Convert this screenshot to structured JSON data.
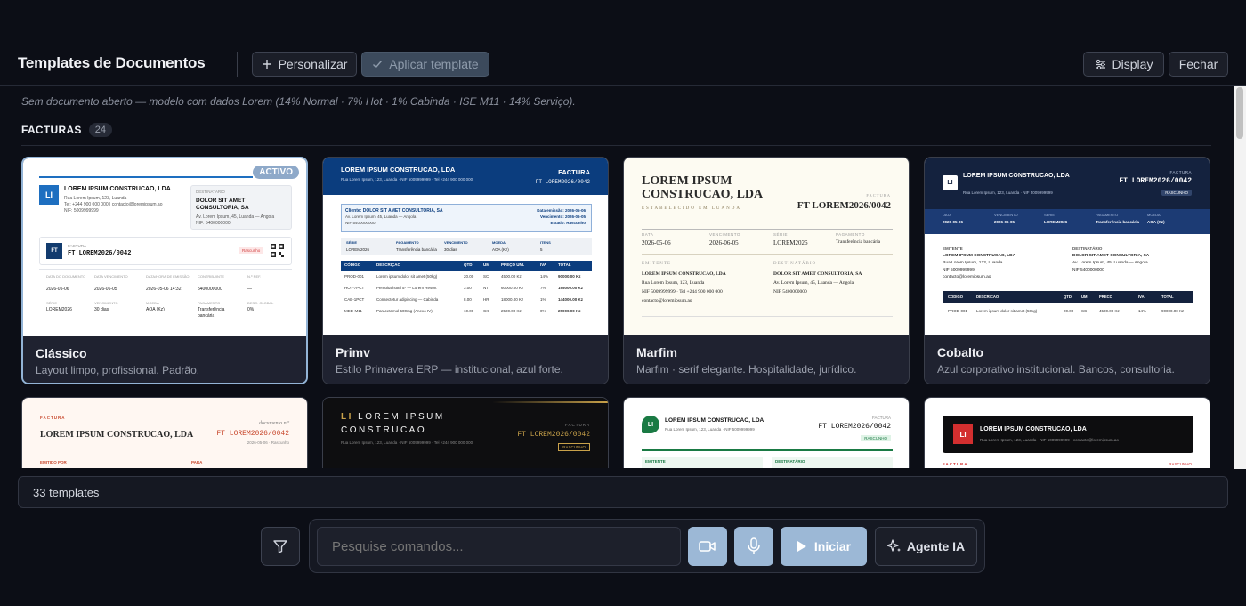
{
  "header": {
    "title": "Templates de Documentos",
    "customize_label": "Personalizar",
    "apply_label": "Aplicar template",
    "display_label": "Display",
    "close_label": "Fechar"
  },
  "subtitle": "Sem documento aberto — modelo com dados Lorem (14% Normal · 7% Hot · 1% Cabinda · ISE M11 · 14% Serviço).",
  "section": {
    "label": "FACTURAS",
    "count": "24"
  },
  "active_badge": "ACTIVO",
  "colors": {
    "accent": "#9cb8d6",
    "background": "#0c0e16",
    "card": "#1f2230",
    "active_border": "#93b4d6"
  },
  "cards": [
    {
      "name": "Clássico",
      "desc": "Layout limpo, profissional. Padrão.",
      "active": true
    },
    {
      "name": "Primv",
      "desc": "Estilo Primavera ERP — institucional, azul forte."
    },
    {
      "name": "Marfim",
      "desc": "Marfim · serif elegante. Hospitalidade, jurídico."
    },
    {
      "name": "Cobalto",
      "desc": "Azul corporativo institucional. Bancos, consultoria."
    }
  ],
  "previews": {
    "classico": {
      "company": "LOREM IPSUM CONSTRUCAO, LDA",
      "address": "Rua Lorem Ipsum, 123, Luanda",
      "contact": "Tel: +244 900 000 000 | contacto@loremipsum.ao",
      "nif": "NIF: 5009999999",
      "logo": "LI",
      "dest_label": "DESTINATÁRIO",
      "dest_name": "DOLOR SIT AMET CONSULTORIA, SA",
      "dest_addr": "Av. Lorem Ipsum, 45, Luanda — Angola",
      "dest_nif": "NIF: 5400000000",
      "ft_logo": "FT",
      "doc_type": "FACTURA",
      "doc_num": "FT LOREM2026/0042",
      "status": "Rascunho",
      "row1_labels": [
        "DATA DO DOCUMENTO",
        "DATA VENCIMENTO",
        "DATA/HORA DE EMISSÃO",
        "CONTRIBUINTE",
        "N.º REF."
      ],
      "row1_values": [
        "2026-05-06",
        "2026-06-05",
        "2026-05-06 14:32",
        "5400000000",
        "—"
      ],
      "row2_labels": [
        "SÉRIE",
        "VENCIMENTO",
        "MOEDA",
        "PAGAMENTO",
        "DESC. GLOBAL"
      ],
      "row2_values": [
        "LOREM2026",
        "30 dias",
        "AOA (Kz)",
        "Transferência bancária",
        "0%"
      ]
    },
    "primv": {
      "company": "LOREM IPSUM CONSTRUCAO, LDA",
      "address": "Rua Lorem Ipsum, 123, Luanda · NIF 5009999999 · Tel +244 900 000 000",
      "doc_type": "FACTURA",
      "doc_num": "FT LOREM2026/0042",
      "client": "Cliente: DOLOR SIT AMET CONSULTORIA, SA",
      "client_addr": "Av. Lorem Ipsum, 45, Luanda — Angola",
      "client_nif": "NIF 5400000000",
      "dates": [
        "Data emissão: 2026-05-06",
        "Vencimento: 2026-06-05",
        "Estado: Rascunho"
      ],
      "meta_labels": [
        "SÉRIE",
        "PAGAMENTO",
        "VENCIMENTO",
        "MOEDA",
        "ITENS"
      ],
      "meta_values": [
        "LOREM2026",
        "Transferência bancária",
        "30 dias",
        "AOA (Kz)",
        "5"
      ],
      "table_head": [
        "CÓDIGO",
        "DESCRIÇÃO",
        "QTD",
        "UM",
        "PREÇO UNI.",
        "IVA",
        "TOTAL"
      ],
      "rows": [
        [
          "PROD-001",
          "Lorem ipsum dolor sit amet (50kg)",
          "20.00",
          "SC",
          "4500.00 Kz",
          "14%",
          "90000.00 Kz"
        ],
        [
          "HOT-7PCT",
          "Pernoita hotel 5* — Lorem Resort",
          "3.00",
          "NT",
          "60000.00 Kz",
          "7%",
          "195000.00 Kz"
        ],
        [
          "CAB-1PCT",
          "Consectetur adipiscing — Cabinda",
          "8.00",
          "HR",
          "18000.00 Kz",
          "1%",
          "144000.00 Kz"
        ],
        [
          "MED-M11",
          "Paracetamol 500mg (Anexo IV)",
          "10.00",
          "CX",
          "2500.00 Kz",
          "0%",
          "25000.00 Kz"
        ]
      ]
    },
    "marfim": {
      "company": "LOREM IPSUM CONSTRUCAO, LDA",
      "tagline": "ESTABELECIDO EM LUANDA",
      "doc_type": "FACTURA",
      "doc_num": "FT LOREM2026/0042",
      "meta_labels": [
        "DATA",
        "VENCIMENTO",
        "SÉRIE",
        "PAGAMENTO"
      ],
      "meta_values": [
        "2026-05-06",
        "2026-06-05",
        "LOREM2026",
        "Transferência bancária"
      ],
      "emit_label": "EMITENTE",
      "emit": [
        "LOREM IPSUM CONSTRUCAO, LDA",
        "Rua Lorem Ipsum, 123, Luanda",
        "NIF 5009999999 · Tel +244 900 000 000",
        "contacto@loremipsum.ao"
      ],
      "dest_label": "DESTINATÁRIO",
      "dest": [
        "DOLOR SIT AMET CONSULTORIA, SA",
        "Av. Lorem Ipsum, 45, Luanda — Angola",
        "NIF 5400000000"
      ]
    },
    "cobalto": {
      "logo": "LI",
      "company": "LOREM IPSUM CONSTRUCAO, LDA",
      "address": "Rua Lorem Ipsum, 123, Luanda · NIF 5009999999",
      "doc_type": "FACTURA",
      "doc_num": "FT LOREM2026/0042",
      "status": "RASCUNHO",
      "meta_labels": [
        "DATA",
        "VENCIMENTO",
        "SÉRIE",
        "PAGAMENTO",
        "MOEDA"
      ],
      "meta_values": [
        "2026-05-06",
        "2026-06-05",
        "LOREM2026",
        "Transferência bancária",
        "AOA (Kz)"
      ],
      "emit_label": "EMITENTE",
      "emit": [
        "LOREM IPSUM CONSTRUCAO, LDA",
        "Rua Lorem Ipsum, 123, Luanda",
        "NIF 5009999999",
        "contacto@loremipsum.ao"
      ],
      "dest_label": "DESTINATÁRIO",
      "dest": [
        "DOLOR SIT AMET CONSULTORIA, SA",
        "Av. Lorem Ipsum, 45, Luanda — Angola",
        "NIF 5400000000"
      ],
      "table_head": [
        "CODIGO",
        "DESCRICAO",
        "QTD",
        "UM",
        "PRECO",
        "IVA",
        "TOTAL"
      ],
      "row": [
        "PROD-001",
        "Lorem ipsum dolor sit amet (50kg)",
        "20.00",
        "SC",
        "4500.00 Kz",
        "14%",
        "90000.00 Kz"
      ]
    },
    "row2": [
      {
        "doc_type": "FACTURA",
        "company": "LOREM IPSUM CONSTRUCAO, LDA",
        "script": "documento n.º",
        "doc_num": "FT LOREM2026/0042",
        "sub": "2026-05-06 · Rascunho",
        "labels": [
          "EMITIDO POR",
          "PARA"
        ]
      },
      {
        "logo": "LI",
        "company_l1": "LOREM IPSUM",
        "company_l2": "CONSTRUCAO",
        "address": "Rua Lorem Ipsum, 123, Luanda · NIF 5009999999 · Tel +244 900 000 000",
        "doc_type": "FACTURA",
        "doc_num": "FT LOREM2026/0042",
        "status": "RASCUNHO"
      },
      {
        "logo": "LI",
        "company": "LOREM IPSUM CONSTRUCAO, LDA",
        "address": "Rua Lorem Ipsum, 123, Luanda · NIF 5009999999",
        "doc_type": "FACTURA",
        "doc_num": "FT LOREM2026/0042",
        "status": "RASCUNHO",
        "labels": [
          "EMITENTE",
          "DESTINATÁRIO"
        ]
      },
      {
        "logo": "LI",
        "company": "LOREM IPSUM CONSTRUCAO, LDA",
        "address": "Rua Lorem Ipsum, 123, Luanda · NIF 5009999999 · contacto@loremipsum.ao",
        "doc_type": "FACTURA",
        "status": "RASCUNHO"
      }
    ]
  },
  "footer": {
    "count_text": "33 templates",
    "search_placeholder": "Pesquise comandos...",
    "start_label": "Iniciar",
    "agent_label": "Agente IA"
  },
  "icons": {
    "filter": "filter-icon",
    "video": "video-icon",
    "mic": "mic-icon",
    "play": "play-icon",
    "sparkle": "sparkle-icon",
    "plus": "plus-icon",
    "check": "check-icon",
    "sliders": "sliders-icon"
  }
}
